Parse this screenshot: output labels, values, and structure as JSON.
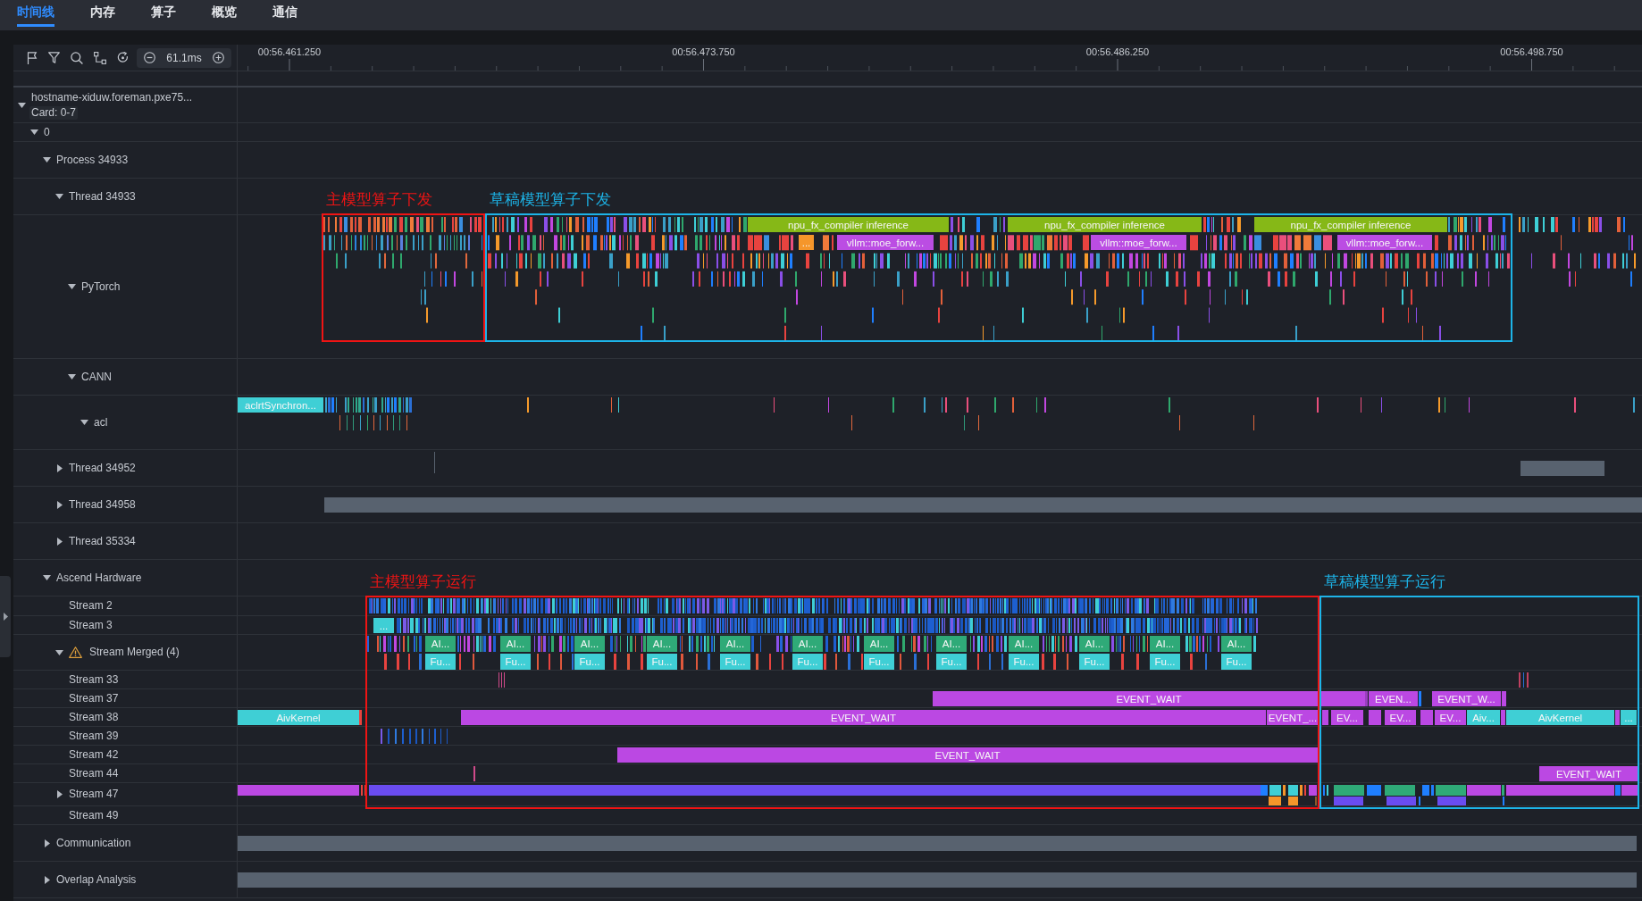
{
  "tabs": [
    {
      "label": "时间线",
      "selected": true
    },
    {
      "label": "内存",
      "selected": false
    },
    {
      "label": "算子",
      "selected": false
    },
    {
      "label": "概览",
      "selected": false
    },
    {
      "label": "通信",
      "selected": false
    }
  ],
  "toolbar": {
    "zoom_level": "61.1ms"
  },
  "time_axis": {
    "labels": [
      "00:56.461.250",
      "00:56.473.750",
      "00:56.486.250",
      "00:56.498.750"
    ]
  },
  "tracks": [
    {
      "label": "hostname-xiduw.foreman.pxe75...",
      "subtitle": "Card: 0-7",
      "expanded": true,
      "children": [
        {
          "label": "0",
          "expanded": true,
          "children": [
            {
              "label": "Process 34933",
              "expanded": true,
              "children": [
                {
                  "label": "Thread 34933",
                  "expanded": true,
                  "children": [
                    {
                      "label": "PyTorch",
                      "expanded": true,
                      "slices": [
                        {
                          "label": "npu_fx_compiler inference",
                          "color": "#86b817"
                        },
                        {
                          "label": "npu_fx_compiler inference",
                          "color": "#86b817"
                        },
                        {
                          "label": "npu_fx_compiler inference",
                          "color": "#86b817"
                        },
                        {
                          "label": "...",
                          "color": "#f5962a"
                        },
                        {
                          "label": "vllm::moe_forw...",
                          "color": "#bb4de3"
                        },
                        {
                          "label": "vllm::moe_forw...",
                          "color": "#bb4de3"
                        },
                        {
                          "label": "vllm::moe_forw...",
                          "color": "#bb4de3"
                        }
                      ]
                    },
                    {
                      "label": "CANN",
                      "expanded": true,
                      "children": [
                        {
                          "label": "acl",
                          "expanded": true,
                          "slices": [
                            {
                              "label": "aclrtSynchron...",
                              "color": "#3fcfd5"
                            }
                          ]
                        }
                      ]
                    }
                  ]
                },
                {
                  "label": "Thread 34952",
                  "expanded": false
                },
                {
                  "label": "Thread 34958",
                  "expanded": false
                },
                {
                  "label": "Thread 35334",
                  "expanded": false
                }
              ]
            },
            {
              "label": "Ascend Hardware",
              "expanded": true,
              "children": [
                {
                  "label": "Stream 2"
                },
                {
                  "label": "Stream 3",
                  "slices": [
                    {
                      "label": "...",
                      "color": "#3fcfd5"
                    }
                  ]
                },
                {
                  "label": "Stream Merged (4)",
                  "expanded": true,
                  "warning": true,
                  "slices": [
                    {
                      "label": "AI...",
                      "color": "#2faa78"
                    },
                    {
                      "label": "AI...",
                      "color": "#2faa78"
                    },
                    {
                      "label": "AI...",
                      "color": "#2faa78"
                    },
                    {
                      "label": "AI...",
                      "color": "#2faa78"
                    },
                    {
                      "label": "AI...",
                      "color": "#2faa78"
                    },
                    {
                      "label": "AI...",
                      "color": "#2faa78"
                    },
                    {
                      "label": "AI...",
                      "color": "#2faa78"
                    },
                    {
                      "label": "AI...",
                      "color": "#2faa78"
                    },
                    {
                      "label": "AI...",
                      "color": "#2faa78"
                    },
                    {
                      "label": "AI...",
                      "color": "#2faa78"
                    },
                    {
                      "label": "AI...",
                      "color": "#2faa78"
                    },
                    {
                      "label": "AI...",
                      "color": "#2faa78"
                    },
                    {
                      "label": "Fu...",
                      "color": "#3fcfd5"
                    },
                    {
                      "label": "Fu...",
                      "color": "#3fcfd5"
                    },
                    {
                      "label": "Fu...",
                      "color": "#3fcfd5"
                    },
                    {
                      "label": "Fu...",
                      "color": "#3fcfd5"
                    },
                    {
                      "label": "Fu...",
                      "color": "#3fcfd5"
                    },
                    {
                      "label": "Fu...",
                      "color": "#3fcfd5"
                    },
                    {
                      "label": "Fu...",
                      "color": "#3fcfd5"
                    },
                    {
                      "label": "Fu...",
                      "color": "#3fcfd5"
                    },
                    {
                      "label": "Fu...",
                      "color": "#3fcfd5"
                    },
                    {
                      "label": "Fu...",
                      "color": "#3fcfd5"
                    },
                    {
                      "label": "Fu...",
                      "color": "#3fcfd5"
                    },
                    {
                      "label": "Fu...",
                      "color": "#3fcfd5"
                    }
                  ]
                },
                {
                  "label": "Stream 33"
                },
                {
                  "label": "Stream 37",
                  "slices": [
                    {
                      "label": "EVENT_WAIT",
                      "color": "#bb48e3"
                    },
                    {
                      "label": "EVEN...",
                      "color": "#bb48e3"
                    },
                    {
                      "label": "EVENT_W...",
                      "color": "#bb48e3"
                    }
                  ]
                },
                {
                  "label": "Stream 38",
                  "slices": [
                    {
                      "label": "AivKernel",
                      "color": "#3fcfd5"
                    },
                    {
                      "label": "EVENT_WAIT",
                      "color": "#bb48e3"
                    },
                    {
                      "label": "EVENT_...",
                      "color": "#bb48e3"
                    },
                    {
                      "label": "EV...",
                      "color": "#bb48e3"
                    },
                    {
                      "label": "EV...",
                      "color": "#bb48e3"
                    },
                    {
                      "label": "EV...",
                      "color": "#bb48e3"
                    },
                    {
                      "label": "Aiv...",
                      "color": "#3fcfd5"
                    },
                    {
                      "label": "AivKernel",
                      "color": "#3fcfd5"
                    },
                    {
                      "label": "...",
                      "color": "#3fcfd5"
                    }
                  ]
                },
                {
                  "label": "Stream 39"
                },
                {
                  "label": "Stream 42",
                  "slices": [
                    {
                      "label": "EVENT_WAIT",
                      "color": "#bb48e3"
                    }
                  ]
                },
                {
                  "label": "Stream 44",
                  "slices": [
                    {
                      "label": "EVENT_WAIT",
                      "color": "#bb48e3"
                    }
                  ]
                },
                {
                  "label": "Stream 47",
                  "expanded": false
                },
                {
                  "label": "Stream 49"
                }
              ]
            },
            {
              "label": "Communication",
              "expanded": false
            },
            {
              "label": "Overlap Analysis",
              "expanded": false
            }
          ]
        }
      ]
    }
  ],
  "annotations": [
    {
      "label": "主模型算子下发",
      "color": "#f01414"
    },
    {
      "label": "草稿模型算子下发",
      "color": "#1db4e8"
    },
    {
      "label": "主模型算子运行",
      "color": "#f01414"
    },
    {
      "label": "草稿模型算子运行",
      "color": "#1db4e8"
    }
  ]
}
